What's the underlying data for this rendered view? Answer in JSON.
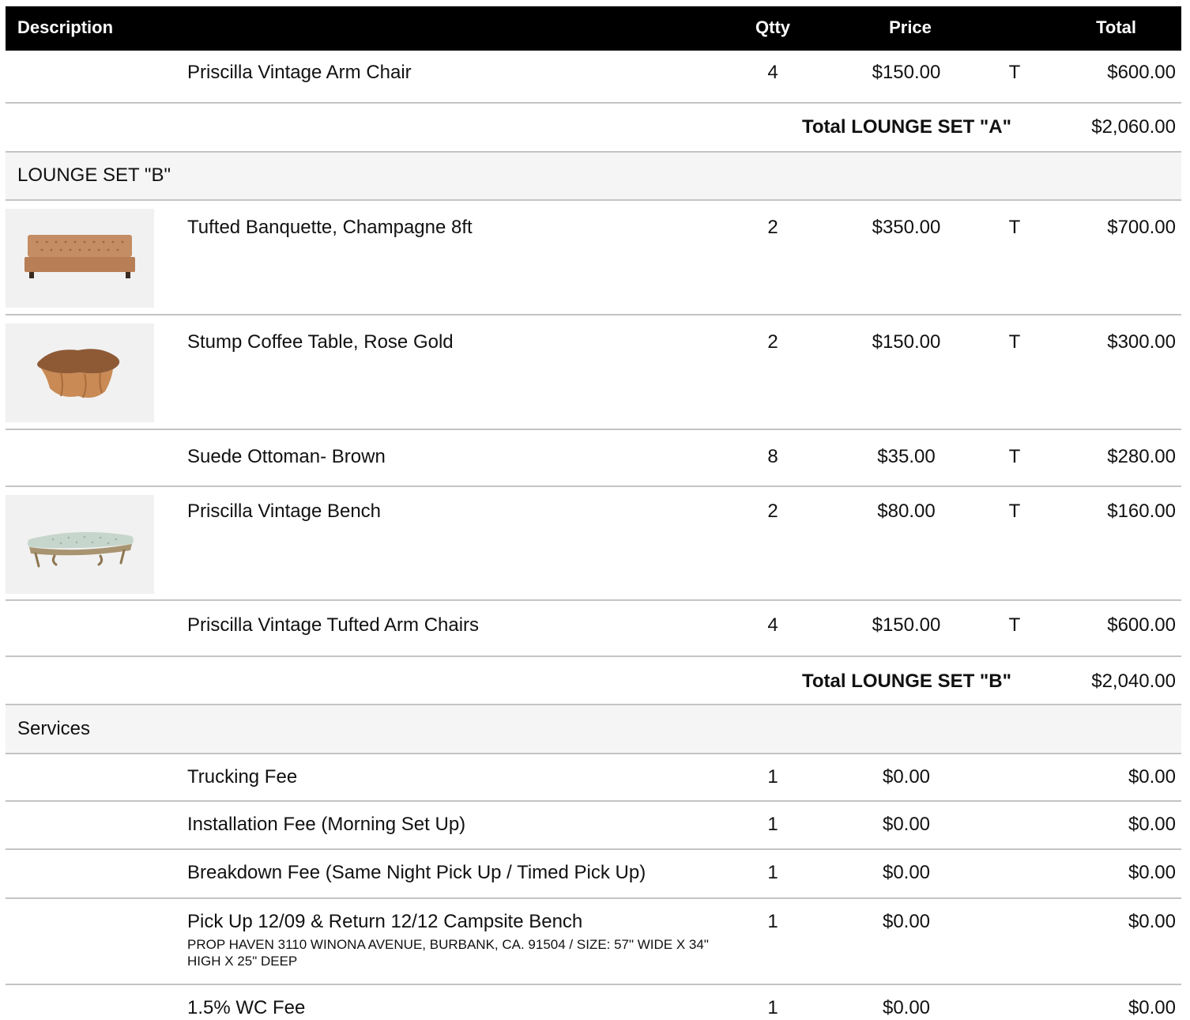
{
  "columns": {
    "description": "Description",
    "qty": "Qtty",
    "price": "Price",
    "total": "Total"
  },
  "lounge_a": {
    "items": [
      {
        "description": "Priscilla Vintage Arm Chair",
        "qty": "4",
        "price": "$150.00",
        "tax": "T",
        "total": "$600.00"
      }
    ],
    "subtotal_label": "Total LOUNGE SET \"A\"",
    "subtotal_value": "$2,060.00"
  },
  "lounge_b": {
    "title": "LOUNGE SET \"B\"",
    "items": [
      {
        "description": "Tufted Banquette, Champagne 8ft",
        "qty": "2",
        "price": "$350.00",
        "tax": "T",
        "total": "$700.00",
        "thumb": "tufted-banquette-photo"
      },
      {
        "description": "Stump Coffee Table, Rose Gold",
        "qty": "2",
        "price": "$150.00",
        "tax": "T",
        "total": "$300.00",
        "thumb": "stump-coffee-table-photo"
      },
      {
        "description": "Suede Ottoman- Brown",
        "qty": "8",
        "price": "$35.00",
        "tax": "T",
        "total": "$280.00"
      },
      {
        "description": "Priscilla Vintage Bench",
        "qty": "2",
        "price": "$80.00",
        "tax": "T",
        "total": "$160.00",
        "thumb": "vintage-bench-photo"
      },
      {
        "description": "Priscilla Vintage Tufted Arm Chairs",
        "qty": "4",
        "price": "$150.00",
        "tax": "T",
        "total": "$600.00"
      }
    ],
    "subtotal_label": "Total LOUNGE SET \"B\"",
    "subtotal_value": "$2,040.00"
  },
  "services": {
    "title": "Services",
    "items": [
      {
        "description": "Trucking Fee",
        "qty": "1",
        "price": "$0.00",
        "total": "$0.00"
      },
      {
        "description": "Installation Fee (Morning Set Up)",
        "qty": "1",
        "price": "$0.00",
        "total": "$0.00"
      },
      {
        "description": "Breakdown Fee (Same Night Pick Up / Timed Pick Up)",
        "qty": "1",
        "price": "$0.00",
        "total": "$0.00"
      },
      {
        "description": "Pick Up 12/09 & Return 12/12 Campsite Bench",
        "sub_description": "PROP HAVEN 3110 WINONA AVENUE, BURBANK, CA. 91504 / SIZE: 57\" WIDE X 34\" HIGH X 25\" DEEP",
        "qty": "1",
        "price": "$0.00",
        "total": "$0.00"
      },
      {
        "description": "1.5% WC Fee",
        "qty": "1",
        "price": "$0.00",
        "total": "$0.00"
      }
    ]
  },
  "colors": {
    "header_bg": "#000000",
    "header_text": "#ffffff",
    "divider": "#c4c4c4",
    "section_bg": "#f5f5f5"
  }
}
